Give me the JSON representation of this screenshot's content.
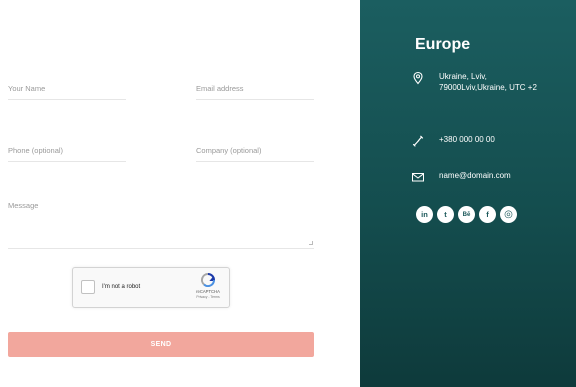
{
  "form": {
    "name_placeholder": "Your Name",
    "email_placeholder": "Email address",
    "phone_placeholder": "Phone (optional)",
    "company_placeholder": "Company (optional)",
    "message_placeholder": "Message",
    "send_label": "SEND"
  },
  "captcha": {
    "label": "I'm not a robot",
    "brand": "reCAPTCHA",
    "links": "Privacy - Terms"
  },
  "contact": {
    "region": "Europe",
    "address": "Ukraine, Lviv, 79000Lviv,Ukraine, UTC +2",
    "phone": "+380 000 00 00",
    "email": "name@domain.com",
    "socials": [
      {
        "name": "linkedin-icon",
        "glyph": "in"
      },
      {
        "name": "twitter-icon",
        "glyph": "t"
      },
      {
        "name": "behance-icon",
        "glyph": "Bē"
      },
      {
        "name": "facebook-icon",
        "glyph": "f"
      },
      {
        "name": "instagram-icon",
        "glyph": "◎"
      }
    ]
  },
  "colors": {
    "panel": "#1b5e60",
    "send_button": "#f2a79d"
  }
}
